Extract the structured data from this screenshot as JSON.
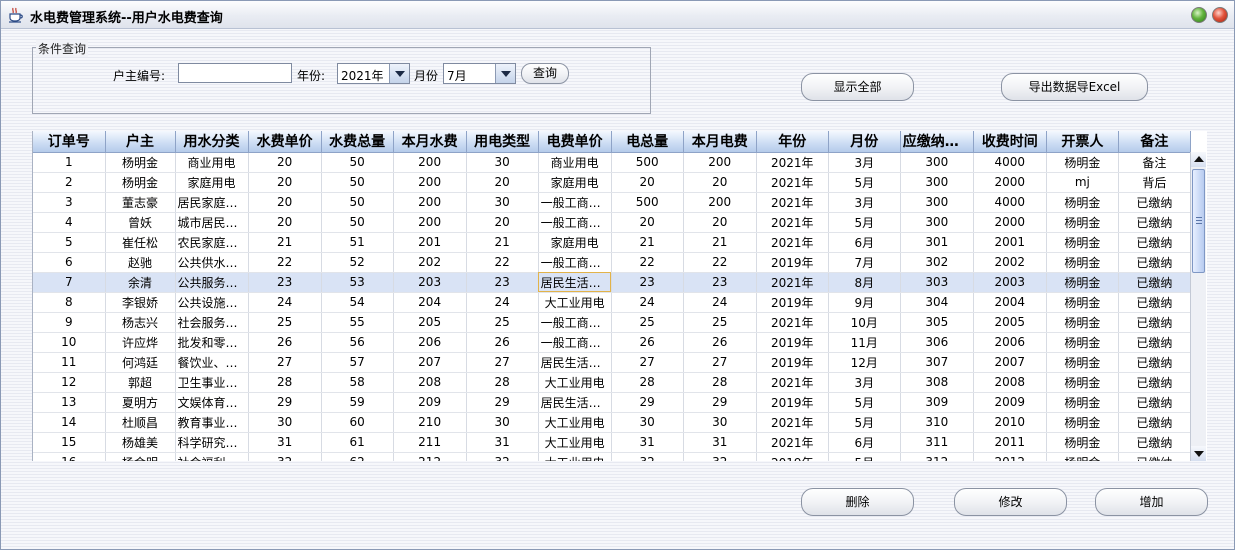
{
  "window": {
    "title": "水电费管理系统--用户水电费查询"
  },
  "condition": {
    "legend": "条件查询",
    "owner_label": "户主编号:",
    "owner_value": "",
    "year_label": "年份:",
    "year_value": "2021年",
    "month_label": "月份",
    "month_value": "7月",
    "search_button": "查询"
  },
  "actions": {
    "show_all": "显示全部",
    "export": "导出数据导Excel",
    "delete": "删除",
    "modify": "修改",
    "add": "增加"
  },
  "table": {
    "columns": [
      "订单号",
      "户主",
      "用水分类",
      "水费单价",
      "水费总量",
      "本月水费",
      "用电类型",
      "电费单价",
      "电总量",
      "本月电费",
      "年份",
      "月份",
      "应缴纳费用",
      "收费时间",
      "开票人",
      "备注"
    ],
    "selected_row": 6,
    "rows": [
      [
        "1",
        "杨明金",
        "商业用电",
        "20",
        "50",
        "200",
        "30",
        "商业用电",
        "500",
        "200",
        "2021年",
        "3月",
        "300",
        "4000",
        "杨明金",
        "备注"
      ],
      [
        "2",
        "杨明金",
        "家庭用电",
        "20",
        "50",
        "200",
        "20",
        "家庭用电",
        "20",
        "20",
        "2021年",
        "5月",
        "300",
        "2000",
        "mj",
        "背后"
      ],
      [
        "3",
        "董志豪",
        "居民家庭用水",
        "20",
        "50",
        "200",
        "30",
        "一般工商业用电",
        "500",
        "200",
        "2021年",
        "3月",
        "300",
        "4000",
        "杨明金",
        "已缴纳"
      ],
      [
        "4",
        "曾妖",
        "城市居民家庭用水",
        "20",
        "50",
        "200",
        "20",
        "一般工商业用电",
        "20",
        "20",
        "2021年",
        "5月",
        "300",
        "2000",
        "杨明金",
        "已缴纳"
      ],
      [
        "5",
        "崔任松",
        "农民家庭用水",
        "21",
        "51",
        "201",
        "21",
        "家庭用电",
        "21",
        "21",
        "2021年",
        "6月",
        "301",
        "2001",
        "杨明金",
        "已缴纳"
      ],
      [
        "6",
        "赵驰",
        "公共供水站用水",
        "22",
        "52",
        "202",
        "22",
        "一般工商业用电",
        "22",
        "22",
        "2019年",
        "7月",
        "302",
        "2002",
        "杨明金",
        "已缴纳"
      ],
      [
        "7",
        "余清",
        "公共服务用水",
        "23",
        "53",
        "203",
        "23",
        "居民生活用电",
        "23",
        "23",
        "2021年",
        "8月",
        "303",
        "2003",
        "杨明金",
        "已缴纳"
      ],
      [
        "8",
        "李银娇",
        "公共设施服务用水",
        "24",
        "54",
        "204",
        "24",
        "大工业用电",
        "24",
        "24",
        "2019年",
        "9月",
        "304",
        "2004",
        "杨明金",
        "已缴纳"
      ],
      [
        "9",
        "杨志兴",
        "社会服务业用水",
        "25",
        "55",
        "205",
        "25",
        "一般工商业用电",
        "25",
        "25",
        "2021年",
        "10月",
        "305",
        "2005",
        "杨明金",
        "已缴纳"
      ],
      [
        "10",
        "许应烨",
        "批发和零售贸易业用水",
        "26",
        "56",
        "206",
        "26",
        "一般工商业用电",
        "26",
        "26",
        "2019年",
        "11月",
        "306",
        "2006",
        "杨明金",
        "已缴纳"
      ],
      [
        "11",
        "何鸿廷",
        "餐饮业、旅馆业用水",
        "27",
        "57",
        "207",
        "27",
        "居民生活用电",
        "27",
        "27",
        "2019年",
        "12月",
        "307",
        "2007",
        "杨明金",
        "已缴纳"
      ],
      [
        "12",
        "郭超",
        "卫生事业用水",
        "28",
        "58",
        "208",
        "28",
        "大工业用电",
        "28",
        "28",
        "2021年",
        "3月",
        "308",
        "2008",
        "杨明金",
        "已缴纳"
      ],
      [
        "13",
        "夏明方",
        "文娱体育事业用水",
        "29",
        "59",
        "209",
        "29",
        "居民生活用电",
        "29",
        "29",
        "2019年",
        "5月",
        "309",
        "2009",
        "杨明金",
        "已缴纳"
      ],
      [
        "14",
        "杜顺昌",
        "教育事业用水",
        "30",
        "60",
        "210",
        "30",
        "大工业用电",
        "30",
        "30",
        "2021年",
        "5月",
        "310",
        "2010",
        "杨明金",
        "已缴纳"
      ],
      [
        "15",
        "杨雄美",
        "科学研究和综合技术服务业用水",
        "31",
        "61",
        "211",
        "31",
        "大工业用电",
        "31",
        "31",
        "2021年",
        "6月",
        "311",
        "2011",
        "杨明金",
        "已缴纳"
      ],
      [
        "16",
        "杨金明",
        "社会福利保障业用水",
        "32",
        "62",
        "212",
        "32",
        "大工业用电",
        "32",
        "32",
        "2019年",
        "5月",
        "312",
        "2012",
        "杨明金",
        "已缴纳"
      ]
    ]
  },
  "colors": {
    "header_bg": "#cbdcf3",
    "selected_row_bg": "#d9e3f5",
    "focus_cell_border": "#e2b34a",
    "close_button": "#e2533c",
    "maximize_button": "#62b33d"
  },
  "icons": {
    "app": "coffee-cup-icon",
    "maximize": "green-circle-icon",
    "close": "red-circle-icon",
    "combo_arrow": "chevron-down-icon",
    "scroll_up": "arrow-up-icon",
    "scroll_down": "arrow-down-icon"
  }
}
